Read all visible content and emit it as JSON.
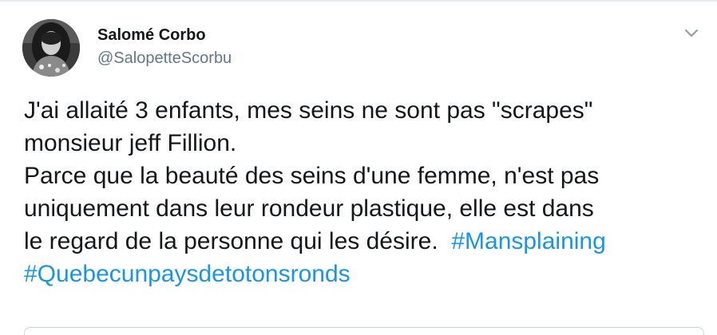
{
  "author": {
    "name": "Salomé Corbo",
    "handle": "@SalopetteScorbu"
  },
  "icons": {
    "avatar": "profile-photo",
    "menu": "chevron-down-icon"
  },
  "tweet": {
    "line1": "J'ai allaité 3 enfants, mes seins ne sont pas \"scrapes\"",
    "line2": "monsieur jeff Fillion.",
    "line3": "Parce que la beauté des seins d'une femme, n'est pas",
    "line4": "uniquement dans leur rondeur plastique, elle est dans",
    "line5_text": "le regard de la personne qui les désire.  ",
    "hashtag1": "#Mansplaining",
    "hashtag2": "#Quebecunpaysdetotonsronds"
  },
  "colors": {
    "text": "#14171a",
    "secondary": "#657786",
    "link": "#1b95e0",
    "border": "#ccd6dd"
  }
}
